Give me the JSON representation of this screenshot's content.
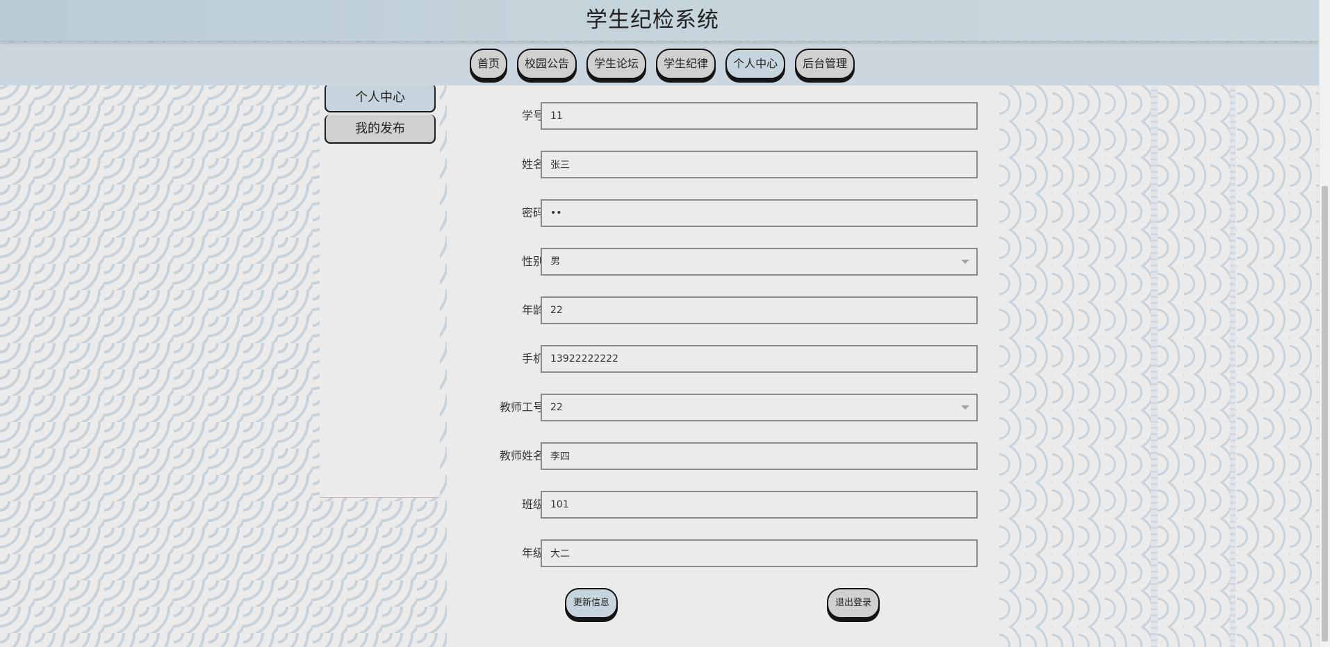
{
  "header": {
    "title": "学生纪检系统"
  },
  "nav": {
    "items": [
      {
        "label": "首页"
      },
      {
        "label": "校园公告"
      },
      {
        "label": "学生论坛"
      },
      {
        "label": "学生纪律"
      },
      {
        "label": "个人中心"
      },
      {
        "label": "后台管理"
      }
    ],
    "active": "个人中心"
  },
  "sidebar": {
    "items": [
      {
        "label": "个人中心"
      },
      {
        "label": "我的发布"
      }
    ]
  },
  "form": {
    "fields": [
      {
        "label": "学号",
        "value": "11"
      },
      {
        "label": "姓名",
        "value": "张三"
      },
      {
        "label": "密码",
        "value": "••"
      },
      {
        "label": "性别",
        "value": "男"
      },
      {
        "label": "年龄",
        "value": "22"
      },
      {
        "label": "手机",
        "value": "13922222222"
      },
      {
        "label": "教师工号",
        "value": "22"
      },
      {
        "label": "教师姓名",
        "value": "李四"
      },
      {
        "label": "班级",
        "value": "101"
      },
      {
        "label": "年级",
        "value": "大二"
      }
    ],
    "update_label": "更新信息",
    "logout_label": "退出登录"
  },
  "colors": {
    "header_bg": "#c5d3db",
    "button_bg": "#d0d0d0",
    "button_active_bg": "#c6d4dd",
    "button_border": "#111111"
  }
}
